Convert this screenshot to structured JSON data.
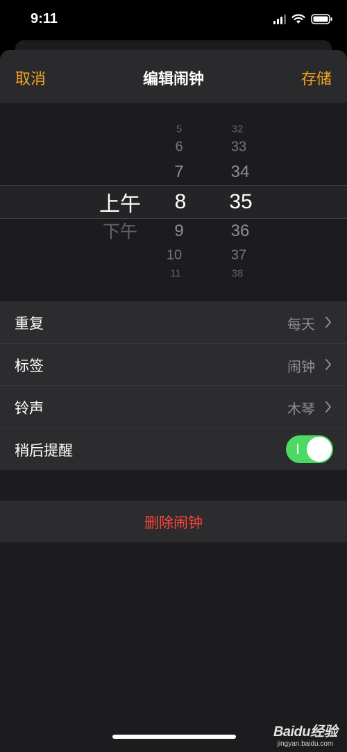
{
  "status_bar": {
    "time": "9:11",
    "icons": [
      "cellular-signal-icon",
      "wifi-icon",
      "battery-icon"
    ]
  },
  "nav": {
    "cancel_label": "取消",
    "title": "编辑闹钟",
    "save_label": "存储",
    "accent_color": "#f5a623"
  },
  "picker": {
    "period": {
      "selected": "上午",
      "after": [
        "下午"
      ]
    },
    "hour": {
      "before": [
        "5",
        "6",
        "7"
      ],
      "selected": "8",
      "after": [
        "9",
        "10",
        "11"
      ]
    },
    "minute": {
      "before": [
        "32",
        "33",
        "34"
      ],
      "selected": "35",
      "after": [
        "36",
        "37",
        "38"
      ]
    }
  },
  "settings": {
    "repeat": {
      "label": "重复",
      "value": "每天"
    },
    "label": {
      "label": "标签",
      "value": "闹钟"
    },
    "sound": {
      "label": "铃声",
      "value": "木琴"
    },
    "snooze": {
      "label": "稍后提醒",
      "enabled": true,
      "on_color": "#4cd964"
    }
  },
  "delete": {
    "label": "删除闹钟",
    "color": "#ff453a"
  },
  "watermark": {
    "main": "Baidu经验",
    "sub": "jingyan.baidu.com"
  }
}
